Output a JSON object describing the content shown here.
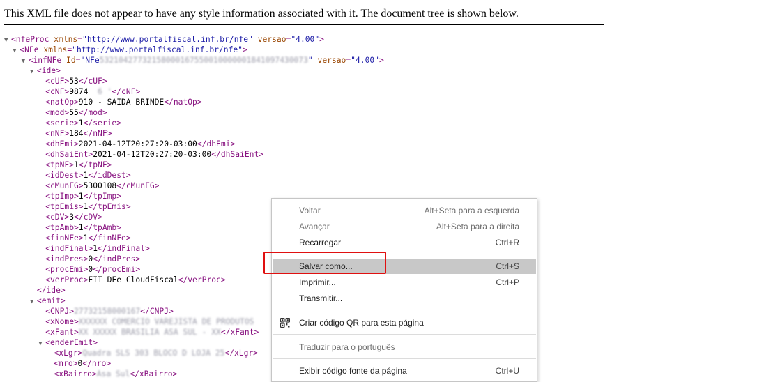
{
  "notice": "This XML file does not appear to have any style information associated with it. The document tree is shown below.",
  "xml_lines": [
    {
      "indent": 0,
      "toggle": "▼",
      "segments": [
        {
          "cls": "tag",
          "t": "<nfeProc "
        },
        {
          "cls": "an",
          "t": "xmlns"
        },
        {
          "cls": "tag",
          "t": "="
        },
        {
          "cls": "av",
          "t": "\"http://www.portalfiscal.inf.br/nfe\""
        },
        {
          "cls": "tag",
          "t": " "
        },
        {
          "cls": "an",
          "t": "versao"
        },
        {
          "cls": "tag",
          "t": "="
        },
        {
          "cls": "av",
          "t": "\"4.00\""
        },
        {
          "cls": "tag",
          "t": ">"
        }
      ]
    },
    {
      "indent": 1,
      "toggle": "▼",
      "segments": [
        {
          "cls": "tag",
          "t": "<NFe "
        },
        {
          "cls": "an",
          "t": "xmlns"
        },
        {
          "cls": "tag",
          "t": "="
        },
        {
          "cls": "av",
          "t": "\"http://www.portalfiscal.inf.br/nfe\""
        },
        {
          "cls": "tag",
          "t": ">"
        }
      ]
    },
    {
      "indent": 2,
      "toggle": "▼",
      "segments": [
        {
          "cls": "tag",
          "t": "<infNFe "
        },
        {
          "cls": "an",
          "t": "Id"
        },
        {
          "cls": "tag",
          "t": "="
        },
        {
          "cls": "av",
          "t": "\"NFe"
        },
        {
          "cls": "blur",
          "t": "53210427732158000167550010000001841097430073"
        },
        {
          "cls": "av",
          "t": "\""
        },
        {
          "cls": "tag",
          "t": " "
        },
        {
          "cls": "an",
          "t": "versao"
        },
        {
          "cls": "tag",
          "t": "="
        },
        {
          "cls": "av",
          "t": "\"4.00\""
        },
        {
          "cls": "tag",
          "t": ">"
        }
      ]
    },
    {
      "indent": 3,
      "toggle": "▼",
      "segments": [
        {
          "cls": "tag",
          "t": "<ide>"
        }
      ]
    },
    {
      "indent": 4,
      "toggle": "",
      "segments": [
        {
          "cls": "tag",
          "t": "<cUF>"
        },
        {
          "cls": "tx",
          "t": "53"
        },
        {
          "cls": "tag",
          "t": "</cUF>"
        }
      ]
    },
    {
      "indent": 4,
      "toggle": "",
      "segments": [
        {
          "cls": "tag",
          "t": "<cNF>"
        },
        {
          "cls": "tx",
          "t": "9874"
        },
        {
          "cls": "blur",
          "t": "  6 '"
        },
        {
          "cls": "tag",
          "t": "</cNF>"
        }
      ]
    },
    {
      "indent": 4,
      "toggle": "",
      "segments": [
        {
          "cls": "tag",
          "t": "<natOp>"
        },
        {
          "cls": "tx",
          "t": "910 - SAIDA BRINDE"
        },
        {
          "cls": "tag",
          "t": "</natOp>"
        }
      ]
    },
    {
      "indent": 4,
      "toggle": "",
      "segments": [
        {
          "cls": "tag",
          "t": "<mod>"
        },
        {
          "cls": "tx",
          "t": "55"
        },
        {
          "cls": "tag",
          "t": "</mod>"
        }
      ]
    },
    {
      "indent": 4,
      "toggle": "",
      "segments": [
        {
          "cls": "tag",
          "t": "<serie>"
        },
        {
          "cls": "tx",
          "t": "1"
        },
        {
          "cls": "tag",
          "t": "</serie>"
        }
      ]
    },
    {
      "indent": 4,
      "toggle": "",
      "segments": [
        {
          "cls": "tag",
          "t": "<nNF>"
        },
        {
          "cls": "tx",
          "t": "184"
        },
        {
          "cls": "tag",
          "t": "</nNF>"
        }
      ]
    },
    {
      "indent": 4,
      "toggle": "",
      "segments": [
        {
          "cls": "tag",
          "t": "<dhEmi>"
        },
        {
          "cls": "tx",
          "t": "2021-04-12T20:27:20-03:00"
        },
        {
          "cls": "tag",
          "t": "</dhEmi>"
        }
      ]
    },
    {
      "indent": 4,
      "toggle": "",
      "segments": [
        {
          "cls": "tag",
          "t": "<dhSaiEnt>"
        },
        {
          "cls": "tx",
          "t": "2021-04-12T20:27:20-03:00"
        },
        {
          "cls": "tag",
          "t": "</dhSaiEnt>"
        }
      ]
    },
    {
      "indent": 4,
      "toggle": "",
      "segments": [
        {
          "cls": "tag",
          "t": "<tpNF>"
        },
        {
          "cls": "tx",
          "t": "1"
        },
        {
          "cls": "tag",
          "t": "</tpNF>"
        }
      ]
    },
    {
      "indent": 4,
      "toggle": "",
      "segments": [
        {
          "cls": "tag",
          "t": "<idDest>"
        },
        {
          "cls": "tx",
          "t": "1"
        },
        {
          "cls": "tag",
          "t": "</idDest>"
        }
      ]
    },
    {
      "indent": 4,
      "toggle": "",
      "segments": [
        {
          "cls": "tag",
          "t": "<cMunFG>"
        },
        {
          "cls": "tx",
          "t": "5300108"
        },
        {
          "cls": "tag",
          "t": "</cMunFG>"
        }
      ]
    },
    {
      "indent": 4,
      "toggle": "",
      "segments": [
        {
          "cls": "tag",
          "t": "<tpImp>"
        },
        {
          "cls": "tx",
          "t": "1"
        },
        {
          "cls": "tag",
          "t": "</tpImp>"
        }
      ]
    },
    {
      "indent": 4,
      "toggle": "",
      "segments": [
        {
          "cls": "tag",
          "t": "<tpEmis>"
        },
        {
          "cls": "tx",
          "t": "1"
        },
        {
          "cls": "tag",
          "t": "</tpEmis>"
        }
      ]
    },
    {
      "indent": 4,
      "toggle": "",
      "segments": [
        {
          "cls": "tag",
          "t": "<cDV>"
        },
        {
          "cls": "tx",
          "t": "3"
        },
        {
          "cls": "tag",
          "t": "</cDV>"
        }
      ]
    },
    {
      "indent": 4,
      "toggle": "",
      "segments": [
        {
          "cls": "tag",
          "t": "<tpAmb>"
        },
        {
          "cls": "tx",
          "t": "1"
        },
        {
          "cls": "tag",
          "t": "</tpAmb>"
        }
      ]
    },
    {
      "indent": 4,
      "toggle": "",
      "segments": [
        {
          "cls": "tag",
          "t": "<finNFe>"
        },
        {
          "cls": "tx",
          "t": "1"
        },
        {
          "cls": "tag",
          "t": "</finNFe>"
        }
      ]
    },
    {
      "indent": 4,
      "toggle": "",
      "segments": [
        {
          "cls": "tag",
          "t": "<indFinal>"
        },
        {
          "cls": "tx",
          "t": "1"
        },
        {
          "cls": "tag",
          "t": "</indFinal>"
        }
      ]
    },
    {
      "indent": 4,
      "toggle": "",
      "segments": [
        {
          "cls": "tag",
          "t": "<indPres>"
        },
        {
          "cls": "tx",
          "t": "0"
        },
        {
          "cls": "tag",
          "t": "</indPres>"
        }
      ]
    },
    {
      "indent": 4,
      "toggle": "",
      "segments": [
        {
          "cls": "tag",
          "t": "<procEmi>"
        },
        {
          "cls": "tx",
          "t": "0"
        },
        {
          "cls": "tag",
          "t": "</procEmi>"
        }
      ]
    },
    {
      "indent": 4,
      "toggle": "",
      "segments": [
        {
          "cls": "tag",
          "t": "<verProc>"
        },
        {
          "cls": "tx",
          "t": "FIT DFe CloudFiscal"
        },
        {
          "cls": "tag",
          "t": "</verProc>"
        }
      ]
    },
    {
      "indent": 3,
      "toggle": "",
      "segments": [
        {
          "cls": "tag",
          "t": "</ide>"
        }
      ]
    },
    {
      "indent": 3,
      "toggle": "▼",
      "segments": [
        {
          "cls": "tag",
          "t": "<emit>"
        }
      ]
    },
    {
      "indent": 4,
      "toggle": "",
      "segments": [
        {
          "cls": "tag",
          "t": "<CNPJ>"
        },
        {
          "cls": "blur",
          "t": "27732158000167"
        },
        {
          "cls": "tag",
          "t": "</CNPJ>"
        }
      ]
    },
    {
      "indent": 4,
      "toggle": "",
      "segments": [
        {
          "cls": "tag",
          "t": "<xNome>"
        },
        {
          "cls": "blur",
          "t": "XXXXXX COMERCIO VAREJISTA DE PRODUTOS"
        }
      ]
    },
    {
      "indent": 4,
      "toggle": "",
      "segments": [
        {
          "cls": "tag",
          "t": "<xFant>"
        },
        {
          "cls": "blur",
          "t": "XX XXXXX BRASILIA ASA SUL - XX"
        },
        {
          "cls": "tag",
          "t": "</xFant>"
        }
      ]
    },
    {
      "indent": 4,
      "toggle": "▼",
      "segments": [
        {
          "cls": "tag",
          "t": "<enderEmit>"
        }
      ]
    },
    {
      "indent": 5,
      "toggle": "",
      "segments": [
        {
          "cls": "tag",
          "t": "<xLgr>"
        },
        {
          "cls": "blur",
          "t": "Quadra SLS 303 BLOCO D LOJA 25"
        },
        {
          "cls": "tag",
          "t": "</xLgr>"
        }
      ]
    },
    {
      "indent": 5,
      "toggle": "",
      "segments": [
        {
          "cls": "tag",
          "t": "<nro>"
        },
        {
          "cls": "tx",
          "t": "0"
        },
        {
          "cls": "tag",
          "t": "</nro>"
        }
      ]
    },
    {
      "indent": 5,
      "toggle": "",
      "segments": [
        {
          "cls": "tag",
          "t": "<xBairro>"
        },
        {
          "cls": "blur",
          "t": "Asa Sul"
        },
        {
          "cls": "tag",
          "t": "</xBairro>"
        }
      ]
    }
  ],
  "context_menu": {
    "items": [
      {
        "id": "voltar",
        "label": "Voltar",
        "shortcut": "Alt+Seta para a esquerda",
        "disabled": true
      },
      {
        "id": "avancar",
        "label": "Avançar",
        "shortcut": "Alt+Seta para a direita",
        "disabled": true
      },
      {
        "id": "recarregar",
        "label": "Recarregar",
        "shortcut": "Ctrl+R",
        "disabled": false
      },
      {
        "id": "salvar-como",
        "label": "Salvar como...",
        "shortcut": "Ctrl+S",
        "disabled": false,
        "highlighted": true
      },
      {
        "id": "imprimir",
        "label": "Imprimir...",
        "shortcut": "Ctrl+P",
        "disabled": false
      },
      {
        "id": "transmitir",
        "label": "Transmitir...",
        "shortcut": "",
        "disabled": false
      },
      {
        "id": "qr",
        "label": "Criar código QR para esta página",
        "shortcut": "",
        "disabled": false,
        "icon": "qr-code-icon"
      },
      {
        "id": "traduzir",
        "label": "Traduzir para o português",
        "shortcut": "",
        "disabled": true
      },
      {
        "id": "codigo-fonte",
        "label": "Exibir código fonte da página",
        "shortcut": "Ctrl+U",
        "disabled": false
      }
    ]
  },
  "colors": {
    "tag": "#881280",
    "attr_name": "#994500",
    "attr_value": "#1a1aa6",
    "highlight": "#c8c8c8",
    "annotation_box": "#e01010"
  }
}
